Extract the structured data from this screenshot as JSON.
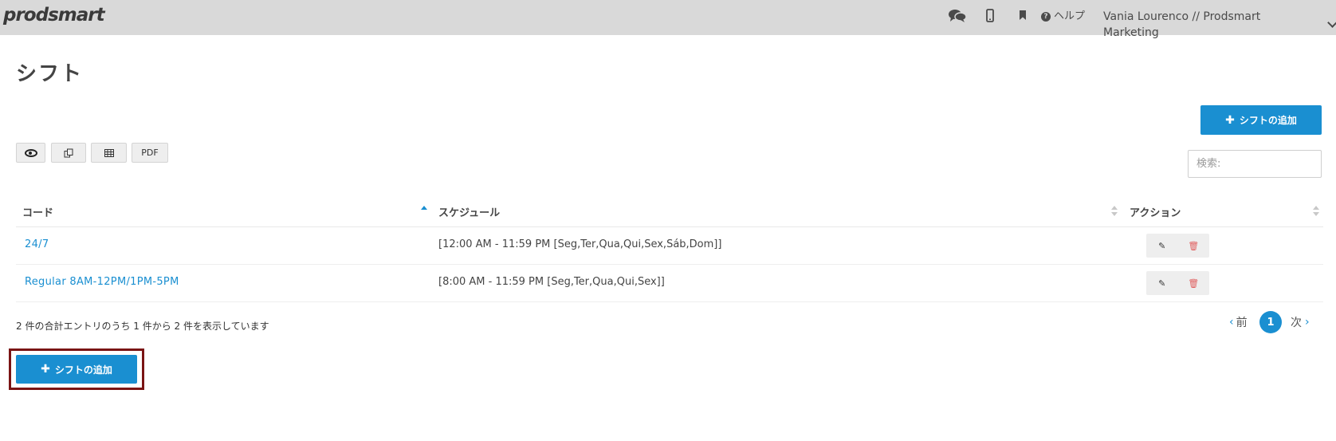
{
  "header": {
    "logo": "prodsmart",
    "help_label": "ヘルプ",
    "user_label": "Vania Lourenco // Prodsmart Marketing",
    "icons": [
      "chat-icon",
      "mobile-icon",
      "bookmark-icon",
      "help-icon",
      "chevron-down-icon"
    ]
  },
  "page": {
    "title": "シフト",
    "add_button_label": "シフトの追加",
    "search_placeholder": "検索:"
  },
  "toolbar": {
    "view_icon": "eye-icon",
    "copy_icon": "copy-icon",
    "grid_icon": "table-icon",
    "pdf_label": "PDF"
  },
  "table": {
    "columns": [
      "コード",
      "スケジュール",
      "アクション"
    ],
    "rows": [
      {
        "code": "24/7",
        "schedule": "[12:00 AM - 11:59 PM [Seg,Ter,Qua,Qui,Sex,Sáb,Dom]]"
      },
      {
        "code": "Regular 8AM-12PM/1PM-5PM",
        "schedule": "[8:00 AM - 11:59 PM [Seg,Ter,Qua,Qui,Sex]]"
      }
    ]
  },
  "footer": {
    "info": "2 件の合計エントリのうち 1 件から 2 件を表示しています",
    "prev_label": "前",
    "next_label": "次",
    "current_page": "1"
  },
  "colors": {
    "accent": "#1a8fd1",
    "topbar": "#d9d9d9",
    "highlight_frame": "#7a1414",
    "delete": "#e06060"
  }
}
